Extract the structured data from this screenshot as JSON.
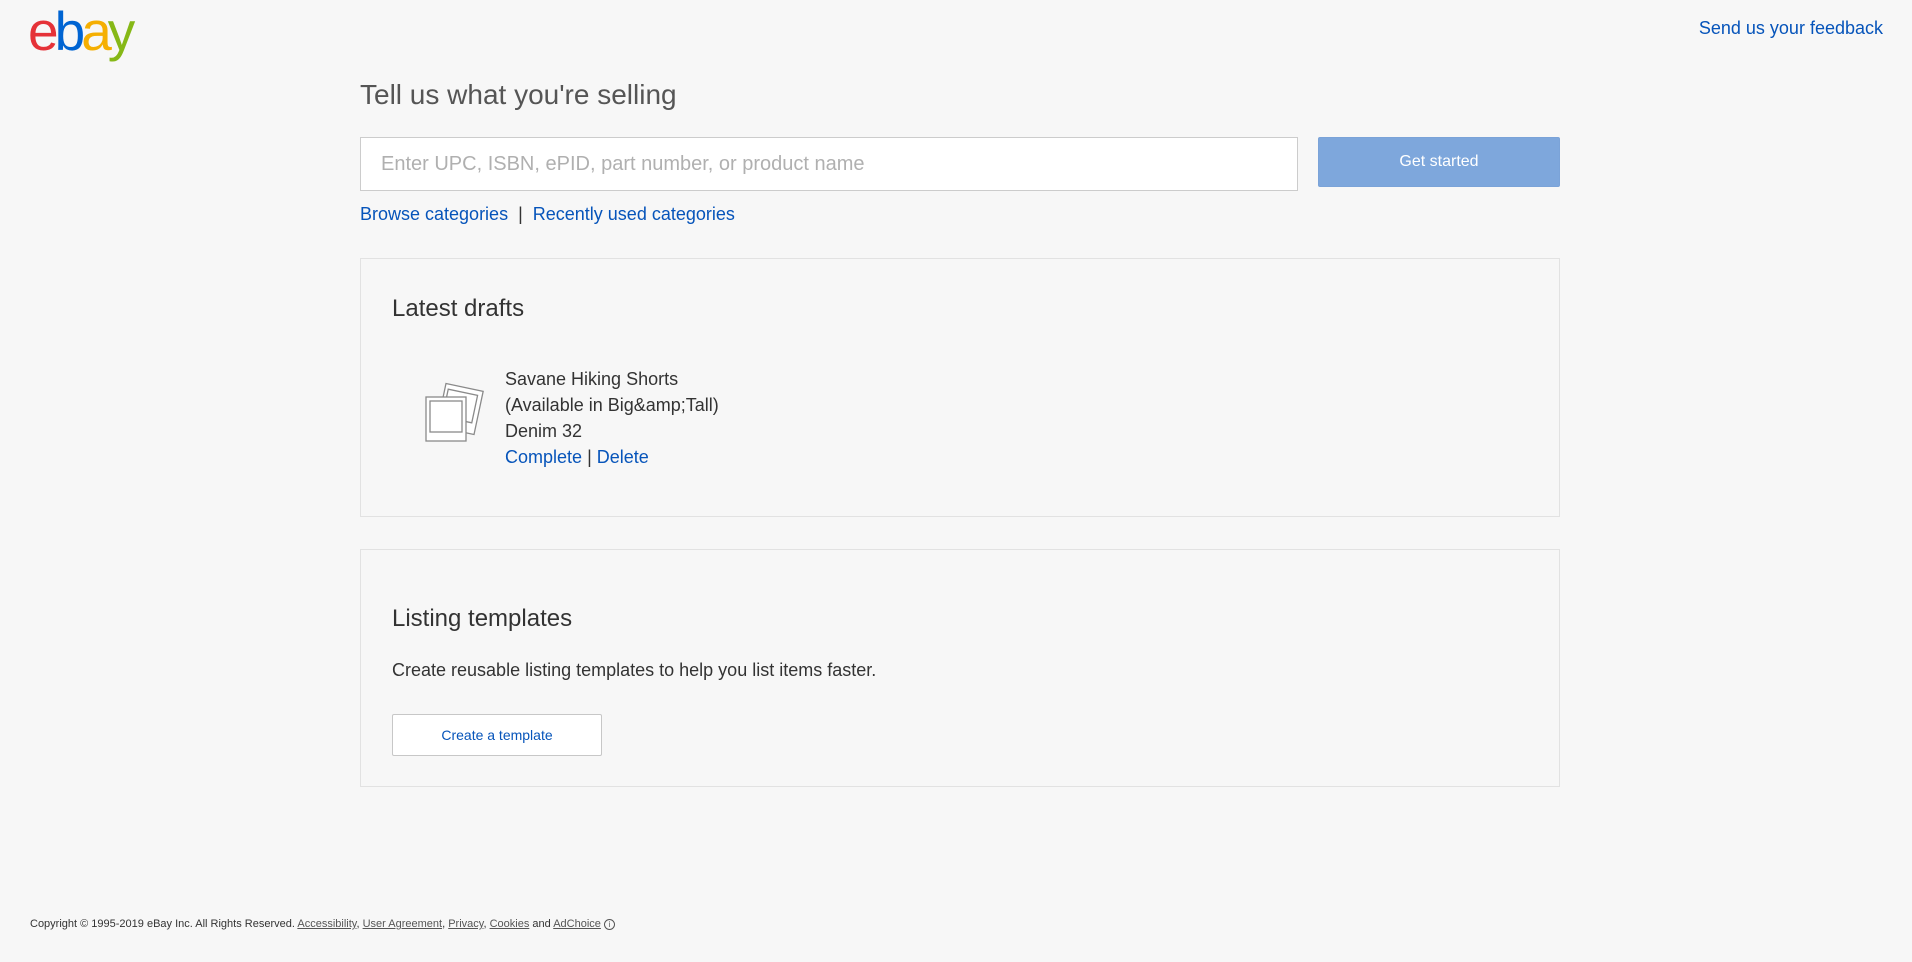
{
  "header": {
    "logo_letters": [
      "e",
      "b",
      "a",
      "y"
    ],
    "feedback_link": "Send us your feedback"
  },
  "sell": {
    "title": "Tell us what you're selling",
    "search_placeholder": "Enter UPC, ISBN, ePID, part number, or product name",
    "search_value": "",
    "get_started_label": "Get started",
    "browse_categories": "Browse categories",
    "separator": "|",
    "recently_used_categories": "Recently used categories"
  },
  "drafts": {
    "title": "Latest drafts",
    "items": [
      {
        "title_lines": [
          "Savane Hiking Shorts",
          "(Available in Big&amp;Tall)",
          "Denim 32"
        ],
        "complete_label": "Complete",
        "separator": "|",
        "delete_label": "Delete"
      }
    ]
  },
  "templates": {
    "title": "Listing templates",
    "description": "Create reusable listing templates to help you list items faster.",
    "create_label": "Create a template"
  },
  "footer": {
    "copyright": "Copyright © 1995-2019 eBay Inc. All Rights Reserved.",
    "links": [
      "Accessibility",
      "User Agreement",
      "Privacy",
      "Cookies",
      "AdChoice"
    ],
    "and_text": "and",
    "info_icon": "info-icon"
  },
  "colors": {
    "link": "#0654ba",
    "primary_button": "#7ea7dc",
    "background": "#f7f7f7",
    "logo_red": "#e53238",
    "logo_blue": "#0064d2",
    "logo_yellow": "#f5af02",
    "logo_green": "#86b817"
  }
}
